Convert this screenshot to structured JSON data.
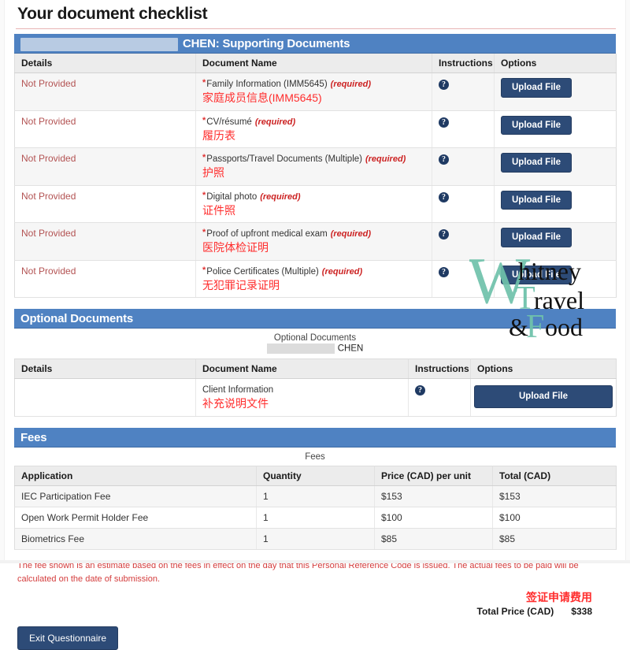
{
  "page": {
    "title": "Your document checklist"
  },
  "supporting": {
    "header_name": "CHEN: Supporting Documents",
    "columns": [
      "Details",
      "Document Name",
      "Instructions",
      "Options"
    ],
    "help_icon": "question-mark-icon",
    "upload_label": "Upload File",
    "status_label": "Not Provided",
    "required_label": "(required)",
    "rows": [
      {
        "status": "Not Provided",
        "name_en": "Family Information (IMM5645)",
        "required": "(required)",
        "name_cn": "家庭成员信息(IMM5645)",
        "option": "Upload File"
      },
      {
        "status": "Not Provided",
        "name_en": "CV/résumé",
        "required": "(required)",
        "name_cn": "履历表",
        "option": "Upload File"
      },
      {
        "status": "Not Provided",
        "name_en": "Passports/Travel Documents (Multiple)",
        "required": "(required)",
        "name_cn": "护照",
        "option": "Upload File"
      },
      {
        "status": "Not Provided",
        "name_en": "Digital photo",
        "required": "(required)",
        "name_cn": "证件照",
        "option": "Upload File"
      },
      {
        "status": "Not Provided",
        "name_en": "Proof of upfront medical exam",
        "required": "(required)",
        "name_cn": "医院体检证明",
        "option": "Upload File"
      },
      {
        "status": "Not Provided",
        "name_en": "Police Certificates (Multiple)",
        "required": "(required)",
        "name_cn": "无犯罪记录证明",
        "option": "Upload File"
      }
    ]
  },
  "optional": {
    "header": "Optional Documents",
    "caption": "Optional Documents",
    "caption_name": "CHEN",
    "columns": [
      "Details",
      "Document Name",
      "Instructions",
      "Options"
    ],
    "rows": [
      {
        "status": "",
        "name_en": "Client Information",
        "name_cn": "补充说明文件",
        "option": "Upload File"
      }
    ]
  },
  "fees": {
    "header": "Fees",
    "caption": "Fees",
    "columns": [
      "Application",
      "Quantity",
      "Price (CAD) per unit",
      "Total (CAD)"
    ],
    "rows": [
      {
        "application": "IEC Participation Fee",
        "quantity": "1",
        "price": "$153",
        "total": "$153"
      },
      {
        "application": "Open Work Permit Holder Fee",
        "quantity": "1",
        "price": "$100",
        "total": "$100"
      },
      {
        "application": "Biometrics Fee",
        "quantity": "1",
        "price": "$85",
        "total": "$85"
      }
    ],
    "footnote": "The fee shown is an estimate based on the fees in effect on the day that this Personal Reference Code is issued. The actual fees to be paid will be calculated on the date of submission.",
    "total_cn": "签证申请费用",
    "total_label": "Total Price (CAD)",
    "total_amount": "$338"
  },
  "footer": {
    "exit_label": "Exit Questionnaire"
  },
  "watermark": {
    "line1_cap": "W",
    "line1": "hitney",
    "line2_cap": "T",
    "line2": "ravel",
    "line3_cap": "&",
    "line3_cap2": "F",
    "line3": "ood"
  },
  "colors": {
    "section_blue": "#4f82c2",
    "button_navy": "#2d4b77",
    "status_red": "#b35353",
    "chinese_red": "#ff2d2d",
    "required_red": "#cc2222",
    "watermark_teal": "#6fc2ab"
  }
}
